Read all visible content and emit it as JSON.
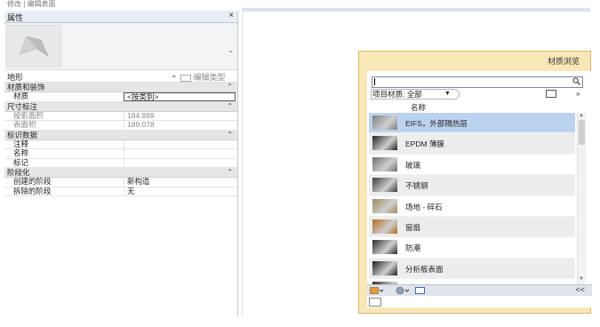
{
  "context_tab": "修改 | 编辑表面",
  "properties": {
    "title": "属性",
    "close_glyph": "×",
    "family_name": "地形",
    "edit_type_label": "编辑类型",
    "sections": [
      {
        "title": "材质和装饰",
        "rows": [
          {
            "label": "材质",
            "value": "<按类别>",
            "boxed": true,
            "dim": false
          }
        ]
      },
      {
        "title": "尺寸标注",
        "rows": [
          {
            "label": "投影面积",
            "value": "184.889",
            "dim": true
          },
          {
            "label": "表面积",
            "value": "189.078",
            "dim": true
          }
        ]
      },
      {
        "title": "标识数据",
        "rows": [
          {
            "label": "注释",
            "value": "",
            "dim": false
          },
          {
            "label": "名称",
            "value": "",
            "dim": false
          },
          {
            "label": "标记",
            "value": "",
            "dim": false
          }
        ]
      },
      {
        "title": "阶段化",
        "rows": [
          {
            "label": "创建的阶段",
            "value": "新构造",
            "dim": false
          },
          {
            "label": "拆除的阶段",
            "value": "无",
            "dim": false
          }
        ]
      }
    ]
  },
  "material_browser": {
    "title": "材质浏览",
    "search_value": "",
    "filter_label": "项目材质: 全部",
    "column_header": "名称",
    "expand_glyph": "»",
    "collapse_glyph": "<<",
    "materials": [
      {
        "name": "EIFS，外部隔热层",
        "swatch": "#7f7f7f",
        "selected": true
      },
      {
        "name": "EPDM 薄膜",
        "swatch": "#222222",
        "selected": false
      },
      {
        "name": "玻璃",
        "swatch": "#6e6e6e",
        "selected": false
      },
      {
        "name": "不锈钢",
        "swatch": "#3a3a3a",
        "selected": false
      },
      {
        "name": "场地 - 碎石",
        "swatch": "#a08a5c",
        "selected": false
      },
      {
        "name": "窗扇",
        "swatch": "#b36b24",
        "selected": false
      },
      {
        "name": "防潮",
        "swatch": "#2a2a2a",
        "selected": false
      },
      {
        "name": "分析板表面",
        "swatch": "#1e1e1e",
        "selected": false
      },
      {
        "name": "",
        "swatch": "#2a2a2a",
        "selected": false
      }
    ]
  }
}
